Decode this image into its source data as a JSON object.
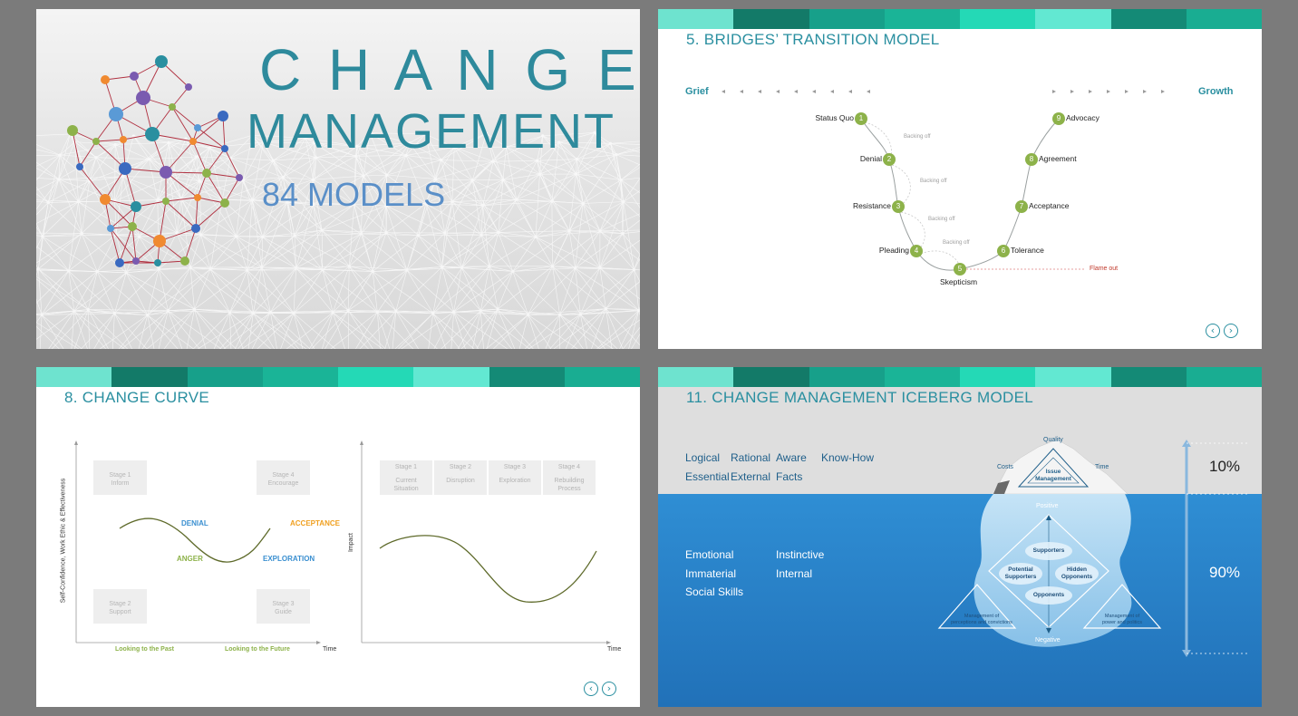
{
  "slide1": {
    "title_line1": "C H A N G E",
    "title_line2": "MANAGEMENT",
    "subtitle": "84 MODELS"
  },
  "slide2": {
    "title": "5. BRIDGES’ TRANSITION MODEL",
    "grief": "Grief",
    "growth": "Growth",
    "stages": [
      {
        "num": "1",
        "label": "Status Quo"
      },
      {
        "num": "2",
        "label": "Denial"
      },
      {
        "num": "3",
        "label": "Resistance"
      },
      {
        "num": "4",
        "label": "Pleading"
      },
      {
        "num": "5",
        "label": "Skepticism"
      },
      {
        "num": "6",
        "label": "Tolerance"
      },
      {
        "num": "7",
        "label": "Acceptance"
      },
      {
        "num": "8",
        "label": "Agreement"
      },
      {
        "num": "9",
        "label": "Advocacy"
      }
    ],
    "backing_off": "Backing off",
    "flame_out": "Flame out",
    "nav_prev": "‹",
    "nav_next": "›"
  },
  "slide3": {
    "title": "8. CHANGE CURVE",
    "ylabel": "Self-Confidence, Work Ethic & Effectiveness",
    "stage1": "Stage 1\nInform",
    "stage2": "Stage 2\nSupport",
    "stage3": "Stage 3\nGuide",
    "stage4": "Stage 4\nEncourage",
    "denial": "DENIAL",
    "anger": "ANGER",
    "exploration": "EXPLORATION",
    "acceptance": "ACCEPTANCE",
    "past": "Looking to the Past",
    "future": "Looking to the Future",
    "time1": "Time",
    "impact": "Impact",
    "time2": "Time",
    "cells": [
      {
        "stage": "Stage 1",
        "desc": "Current\nSituation"
      },
      {
        "stage": "Stage 2",
        "desc": "Disruption"
      },
      {
        "stage": "Stage 3",
        "desc": "Exploration"
      },
      {
        "stage": "Stage 4",
        "desc": "Rebuilding\nProcess"
      }
    ],
    "nav_prev": "‹",
    "nav_next": "›"
  },
  "slide4": {
    "title": "11. CHANGE MANAGEMENT ICEBERG MODEL",
    "above": [
      "Logical",
      "Rational",
      "Aware",
      "Know-How",
      "Essential",
      "External",
      "Facts"
    ],
    "below": [
      "Emotional",
      "Instinctive",
      "Immaterial",
      "Internal",
      "Social Skills"
    ],
    "quality": "Quality",
    "costs": "Costs",
    "time": "Time",
    "issue": "Issue\nManagement",
    "positive": "Positive",
    "negative": "Negative",
    "supporters": "Supporters",
    "potential": "Potential\nSupporters",
    "hidden": "Hidden\nOpponents",
    "opponents": "Opponents",
    "perceptions": "Management of\nperceptions and convictions",
    "power": "Management of\npower and politics",
    "pct_top": "10%",
    "pct_bottom": "90%"
  },
  "colors": {
    "teal_title": "#2a8fa0",
    "stage_green": "#8db24a",
    "flame_red": "#c0392b",
    "water_blue": "#2a86c8"
  }
}
